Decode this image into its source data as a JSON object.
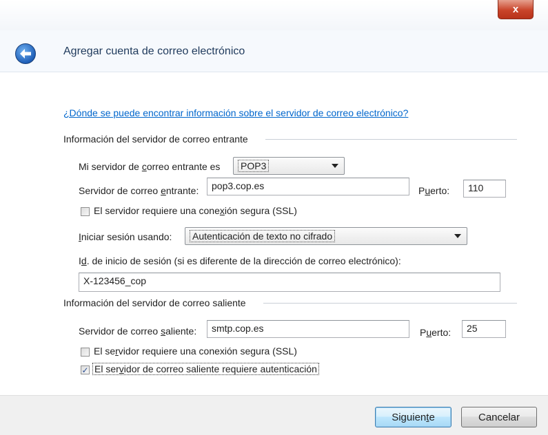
{
  "window": {
    "title": "Agregar cuenta de correo electrónico",
    "close_glyph": "x"
  },
  "help_link": "¿Dónde se puede encontrar información sobre el servidor de correo electrónico?",
  "incoming": {
    "group_label": "Información del servidor de correo entrante",
    "type_label_pre": "Mi servidor de ",
    "type_label_u": "c",
    "type_label_post": "orreo entrante es",
    "type_value": "POP3",
    "server_label_pre": "Servidor de correo ",
    "server_label_u": "e",
    "server_label_post": "ntrante:",
    "server_value": "pop3.cop.es",
    "port_label_pre": "P",
    "port_label_u": "u",
    "port_label_post": "erto:",
    "port_value": "110",
    "ssl_label_pre": "El servidor requiere una cone",
    "ssl_label_u": "x",
    "ssl_label_post": "ión segura (SSL)",
    "ssl_checked": false,
    "logon_label_u": "I",
    "logon_label_post": "niciar sesión usando:",
    "logon_value": "Autenticación de texto no cifrado",
    "logon_id_label_pre": "I",
    "logon_id_label_u": "d",
    "logon_id_label_post": ". de inicio de sesión (si es diferente de la dirección de correo electrónico):",
    "logon_id_value": "X-123456_cop"
  },
  "outgoing": {
    "group_label": "Información del servidor de correo saliente",
    "server_label_pre": "Servidor de correo ",
    "server_label_u": "s",
    "server_label_post": "aliente:",
    "server_value": "smtp.cop.es",
    "port_label_pre": "P",
    "port_label_u": "u",
    "port_label_post": "erto:",
    "port_value": "25",
    "ssl_label_pre": "El se",
    "ssl_label_u": "r",
    "ssl_label_post": "vidor requiere una conexión segura (SSL)",
    "ssl_checked": false,
    "auth_label_pre": "El ser",
    "auth_label_u": "v",
    "auth_label_post": "idor de correo saliente requiere autenticación",
    "auth_checked": true
  },
  "footer": {
    "next_label_pre": "Siguien",
    "next_label_u": "t",
    "next_label_post": "e",
    "cancel_label": "Cancelar"
  },
  "icons": {
    "back": "back-arrow-icon",
    "close": "close-icon",
    "dropdown": "chevron-down-icon",
    "check": "checkmark-icon"
  },
  "colors": {
    "link": "#0066cc",
    "title_text": "#1e395b",
    "close_button": "#c9442a",
    "primary_button_border": "#3c7fb1"
  }
}
